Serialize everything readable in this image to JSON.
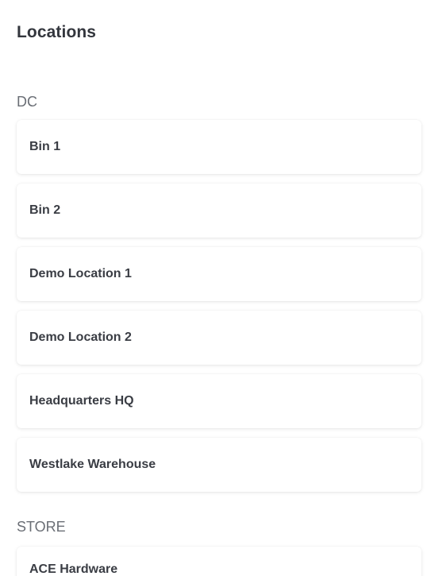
{
  "header": {
    "title": "Locations"
  },
  "groups": [
    {
      "label": "DC",
      "items": [
        {
          "label": "Bin 1"
        },
        {
          "label": "Bin 2"
        },
        {
          "label": "Demo Location 1"
        },
        {
          "label": "Demo Location 2"
        },
        {
          "label": "Headquarters HQ"
        },
        {
          "label": "Westlake Warehouse"
        }
      ]
    },
    {
      "label": "STORE",
      "items": [
        {
          "label": "ACE Hardware"
        }
      ]
    }
  ]
}
